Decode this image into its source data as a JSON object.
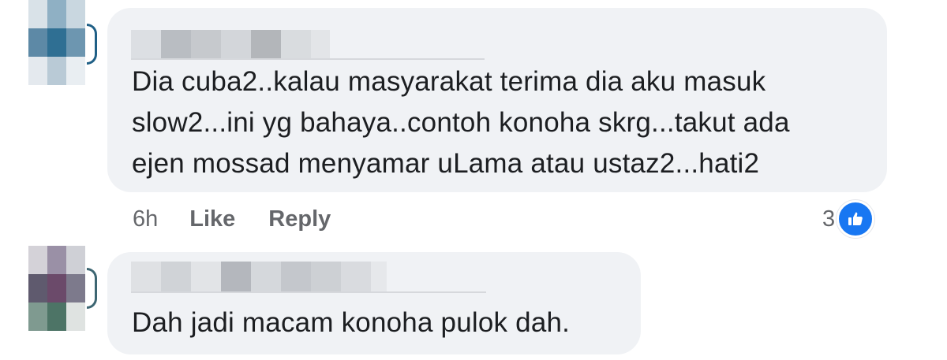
{
  "comments": [
    {
      "text": "Dia cuba2..kalau masyarakat terima dia aku masuk\nslow2...ini yg bahaya..contoh konoha skrg...takut ada\nejen mossad menyamar uLama atau ustaz2...hati2",
      "time": "6h",
      "like_label": "Like",
      "reply_label": "Reply",
      "reaction_count": "3",
      "reaction_icon": "like-thumb-icon"
    },
    {
      "text": "Dah jadi macam konoha pulok dah."
    }
  ],
  "colors": {
    "bubble": "#f0f2f5",
    "like_blue": "#1877f2",
    "meta_text": "#65676b"
  }
}
